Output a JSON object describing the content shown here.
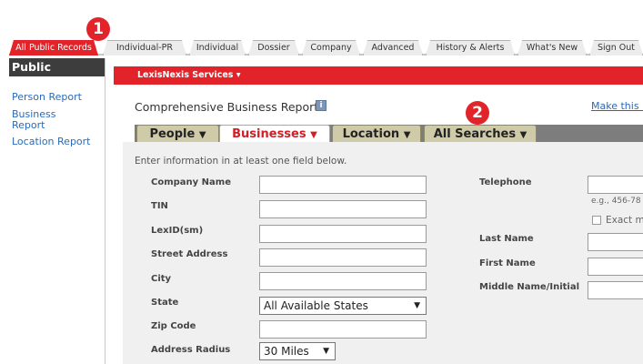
{
  "tabs": [
    {
      "label": "All Public Records",
      "active": true
    },
    {
      "label": "Individual-PR"
    },
    {
      "label": "Individual"
    },
    {
      "label": "Dossier"
    },
    {
      "label": "Company"
    },
    {
      "label": "Advanced"
    },
    {
      "label": "History & Alerts"
    },
    {
      "label": "What's New"
    },
    {
      "label": "Sign Out"
    }
  ],
  "badges": {
    "one": "1",
    "two": "2"
  },
  "sidebar": {
    "title": "Public Records",
    "links": [
      "Person Report",
      "Business Report",
      "Location Report"
    ]
  },
  "services_bar": {
    "label": "LexisNexis Services ▾"
  },
  "report": {
    "title": "Comprehensive Business Report",
    "info_icon": "i",
    "make_link": "Make this m"
  },
  "search_tabs": [
    {
      "label": "People"
    },
    {
      "label": "Businesses",
      "active": true
    },
    {
      "label": "Location"
    },
    {
      "label": "All Searches"
    }
  ],
  "form": {
    "instruction": "Enter information in at least one field below.",
    "left_fields": [
      "Company Name",
      "TIN",
      "LexID(sm)",
      "Street Address",
      "City",
      "State",
      "Zip Code",
      "Address Radius"
    ],
    "state_value": "All Available States",
    "radius_value": "30 Miles",
    "right_fields": [
      "Telephone",
      "Last Name",
      "First Name",
      "Middle Name/Initial"
    ],
    "phone_hint": "e.g., 456-78",
    "exact_label": "Exact ma"
  },
  "colors": {
    "accent_red": "#e2232a",
    "sidebar_dark": "#3d3d3d",
    "link_blue": "#2a6ab8",
    "tab_tan": "#cfcaa8"
  }
}
